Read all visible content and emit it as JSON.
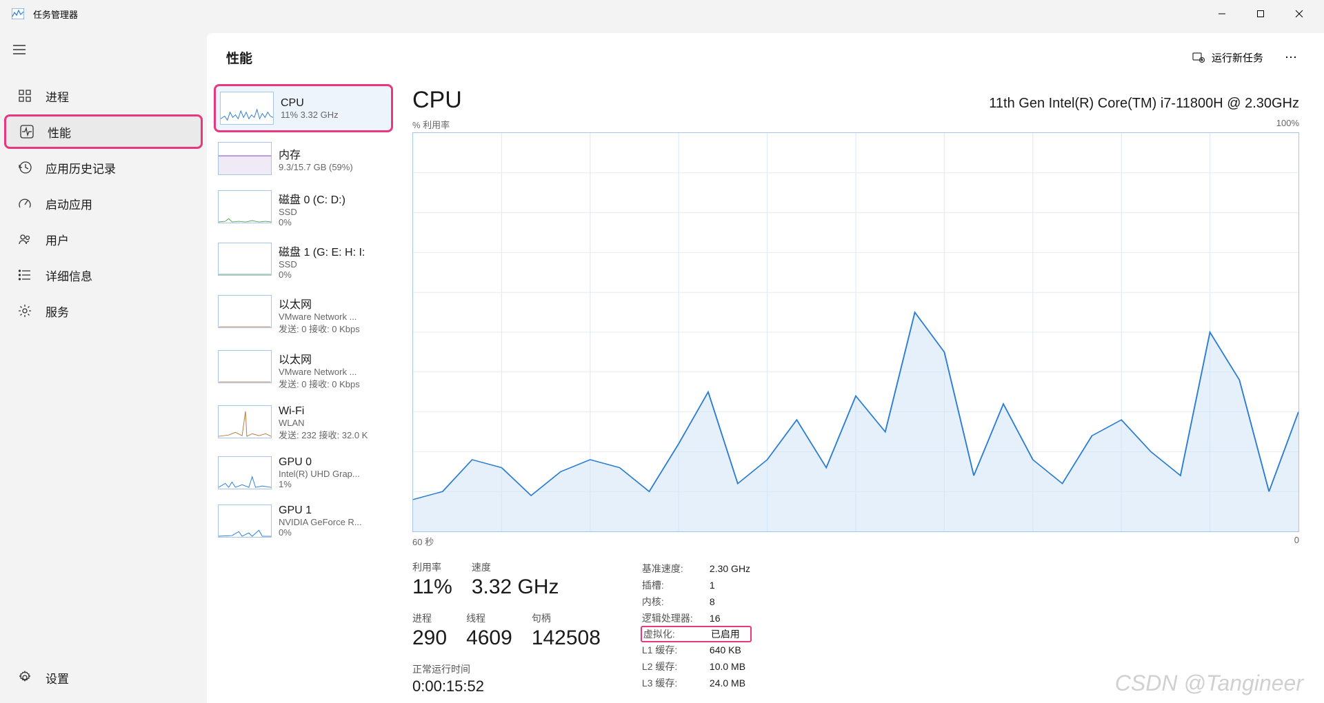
{
  "app": {
    "title": "任务管理器"
  },
  "window_controls": {
    "min": "—",
    "max": "▢",
    "close": "✕"
  },
  "nav": {
    "items": [
      {
        "id": "processes",
        "label": "进程"
      },
      {
        "id": "performance",
        "label": "性能"
      },
      {
        "id": "app-history",
        "label": "应用历史记录"
      },
      {
        "id": "startup",
        "label": "启动应用"
      },
      {
        "id": "users",
        "label": "用户"
      },
      {
        "id": "details",
        "label": "详细信息"
      },
      {
        "id": "services",
        "label": "服务"
      }
    ],
    "settings_label": "设置"
  },
  "header": {
    "page_title": "性能",
    "run_new_task": "运行新任务"
  },
  "perf_items": [
    {
      "title": "CPU",
      "sub": "11%  3.32 GHz"
    },
    {
      "title": "内存",
      "sub": "9.3/15.7 GB (59%)"
    },
    {
      "title": "磁盘 0 (C: D:)",
      "sub1": "SSD",
      "sub2": "0%"
    },
    {
      "title": "磁盘 1 (G: E: H: I:",
      "sub1": "SSD",
      "sub2": "0%"
    },
    {
      "title": "以太网",
      "sub1": "VMware Network ...",
      "sub2": "发送: 0 接收: 0 Kbps"
    },
    {
      "title": "以太网",
      "sub1": "VMware Network ...",
      "sub2": "发送: 0 接收: 0 Kbps"
    },
    {
      "title": "Wi-Fi",
      "sub1": "WLAN",
      "sub2": "发送: 232 接收: 32.0 K"
    },
    {
      "title": "GPU 0",
      "sub1": "Intel(R) UHD Grap...",
      "sub2": "1%"
    },
    {
      "title": "GPU 1",
      "sub1": "NVIDIA GeForce R...",
      "sub2": "0%"
    }
  ],
  "detail": {
    "title": "CPU",
    "cpu_name": "11th Gen Intel(R) Core(TM) i7-11800H @ 2.30GHz",
    "chart_top_left": "% 利用率",
    "chart_top_right": "100%",
    "chart_bottom_left": "60 秒",
    "chart_bottom_right": "0"
  },
  "stats": {
    "util_label": "利用率",
    "util_value": "11%",
    "speed_label": "速度",
    "speed_value": "3.32 GHz",
    "proc_label": "进程",
    "proc_value": "290",
    "thread_label": "线程",
    "thread_value": "4609",
    "handle_label": "句柄",
    "handle_value": "142508",
    "uptime_label": "正常运行时间",
    "uptime_value": "0:00:15:52"
  },
  "info": {
    "base_speed_k": "基准速度:",
    "base_speed_v": "2.30 GHz",
    "sockets_k": "插槽:",
    "sockets_v": "1",
    "cores_k": "内核:",
    "cores_v": "8",
    "logical_k": "逻辑处理器:",
    "logical_v": "16",
    "virt_k": "虚拟化:",
    "virt_v": "已启用",
    "l1_k": "L1 缓存:",
    "l1_v": "640 KB",
    "l2_k": "L2 缓存:",
    "l2_v": "10.0 MB",
    "l3_k": "L3 缓存:",
    "l3_v": "24.0 MB"
  },
  "watermark": "CSDN @Tangineer",
  "chart_data": {
    "type": "line",
    "title": "CPU % 利用率",
    "xlabel": "60 秒 → 0",
    "ylabel": "% 利用率",
    "ylim": [
      0,
      100
    ],
    "x_seconds_ago": [
      60,
      58,
      56,
      54,
      52,
      50,
      48,
      46,
      44,
      42,
      40,
      38,
      36,
      34,
      32,
      30,
      28,
      26,
      24,
      22,
      20,
      18,
      16,
      14,
      12,
      10,
      8,
      6,
      4,
      2,
      0
    ],
    "values": [
      8,
      10,
      18,
      16,
      9,
      15,
      18,
      16,
      10,
      22,
      35,
      12,
      18,
      28,
      16,
      34,
      25,
      55,
      45,
      14,
      32,
      18,
      12,
      24,
      28,
      20,
      14,
      50,
      38,
      10,
      30
    ]
  }
}
